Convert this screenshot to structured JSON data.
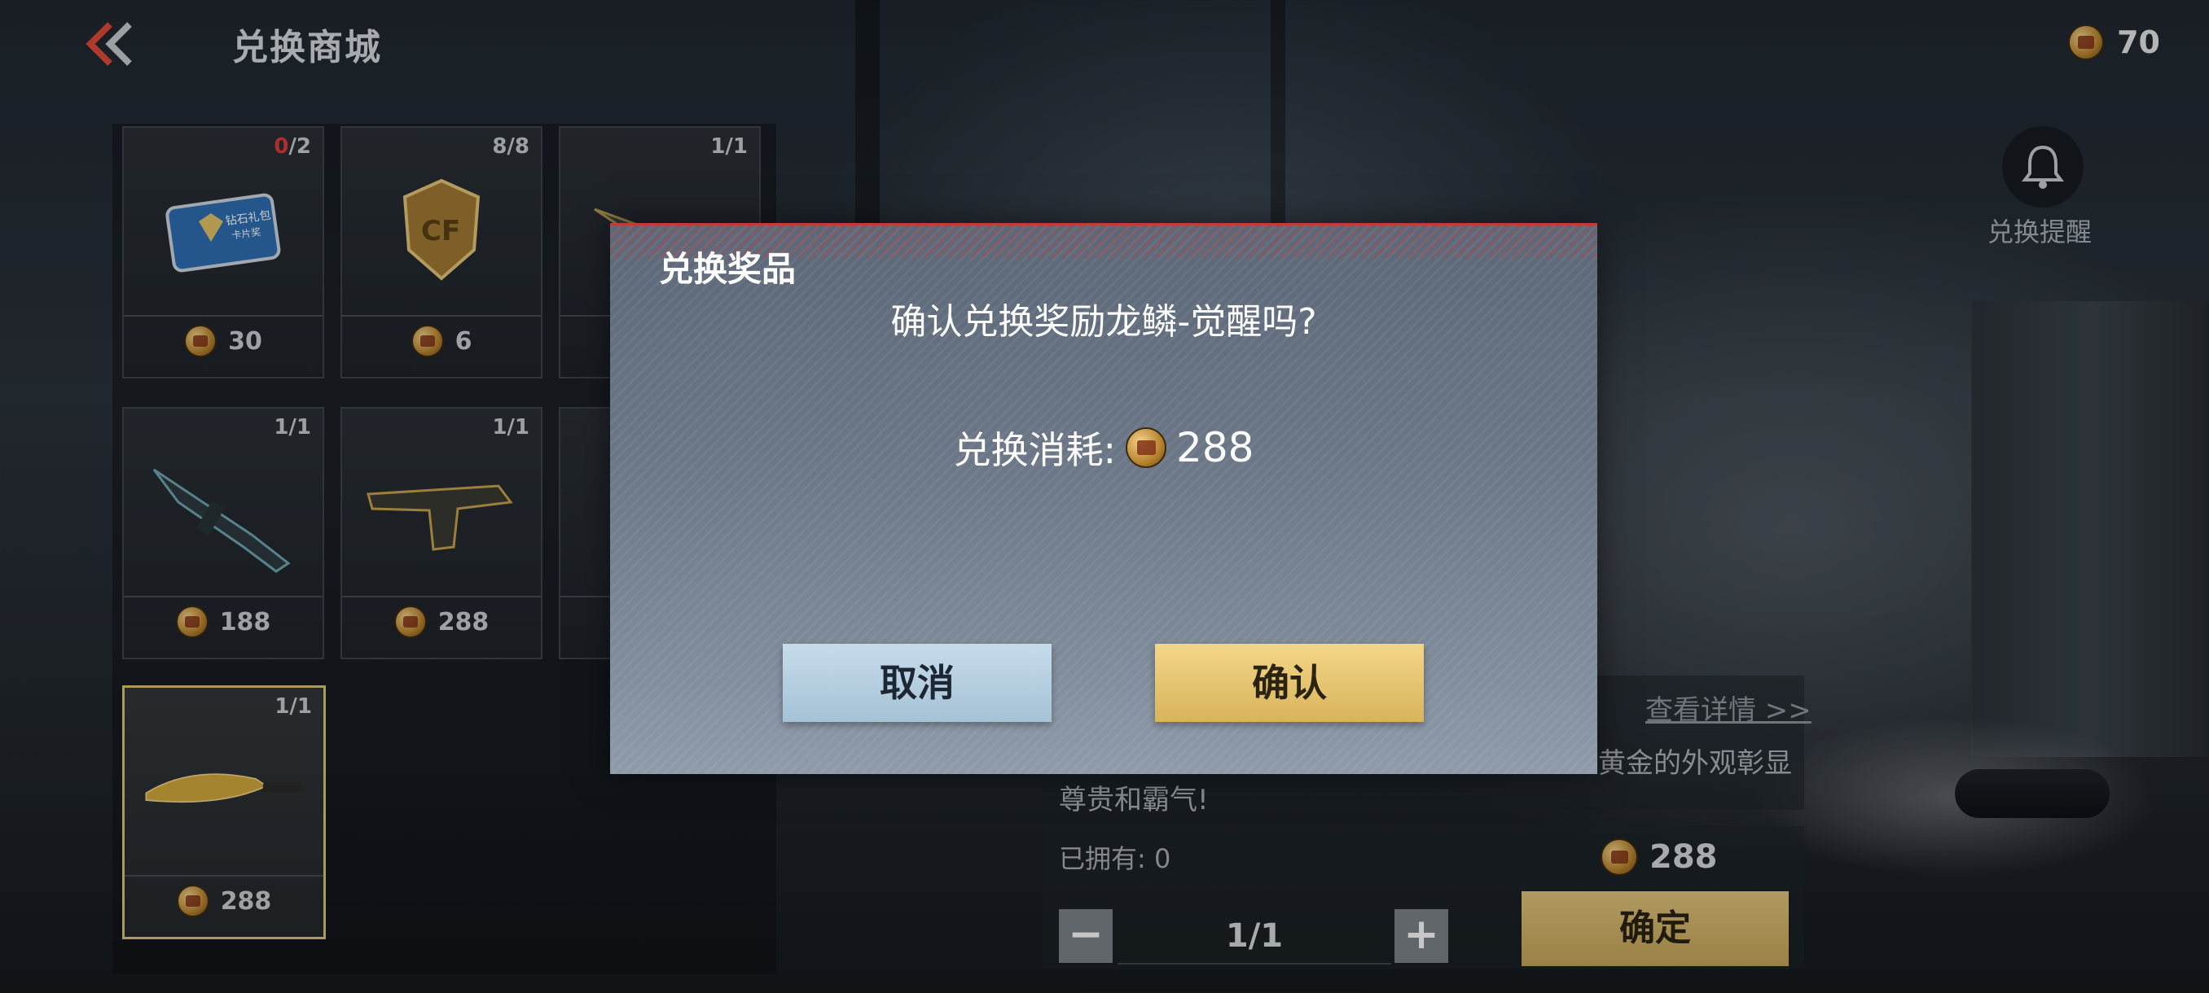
{
  "header": {
    "title": "兑换商城",
    "currency_value": "70"
  },
  "reminder": {
    "label": "兑换提醒"
  },
  "grid": {
    "items": [
      {
        "count_owned": "0",
        "count_total": "/2",
        "price": "30",
        "art": "diamond-card-icon",
        "card_text_1": "钻石礼包",
        "card_text_2": "卡片奖"
      },
      {
        "count": "8/8",
        "price": "6",
        "art": "cf-badge-icon"
      },
      {
        "count": "1/1",
        "price": "",
        "art": "rifle-icon"
      },
      {
        "count": "1/1",
        "price": "188",
        "art": "rifle-icon"
      },
      {
        "count": "1/1",
        "price": "288",
        "art": "pistol-icon"
      },
      {
        "count": "",
        "price": "",
        "art": ""
      },
      {
        "count": "1/1",
        "price": "288",
        "art": "knife-icon"
      }
    ]
  },
  "detail": {
    "link": "查看详情 >>",
    "desc_line1": "黄金的外观彰显",
    "desc_line2": "尊贵和霸气!",
    "owned_label": "已拥有: 0",
    "total_price": "288",
    "qty": "1/1",
    "minus": "−",
    "plus": "+",
    "confirm": "确定"
  },
  "modal": {
    "title": "兑换奖品",
    "question": "确认兑换奖励龙鳞-觉醒吗?",
    "cost_label": "兑换消耗:",
    "cost_value": "288",
    "cancel": "取消",
    "confirm": "确认"
  },
  "colors": {
    "accent_gold": "#d9b35c",
    "cancel_blue": "#a6c2d6",
    "alert_red": "#e23a3a"
  }
}
